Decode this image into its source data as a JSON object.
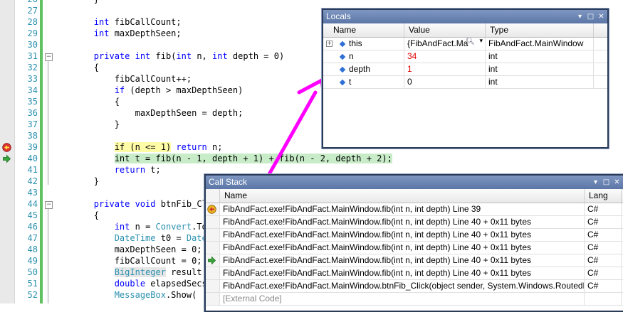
{
  "editor": {
    "lines": [
      {
        "n": "26",
        "segs": [
          {
            "t": "        }",
            "c": ""
          }
        ]
      },
      {
        "n": "27",
        "segs": [
          {
            "t": "",
            "c": ""
          }
        ]
      },
      {
        "n": "28",
        "segs": [
          {
            "t": "        ",
            "c": ""
          },
          {
            "t": "int",
            "c": "kw"
          },
          {
            "t": " fibCallCount;",
            "c": ""
          }
        ]
      },
      {
        "n": "29",
        "segs": [
          {
            "t": "        ",
            "c": ""
          },
          {
            "t": "int",
            "c": "kw"
          },
          {
            "t": " maxDepthSeen;",
            "c": ""
          }
        ]
      },
      {
        "n": "30",
        "segs": [
          {
            "t": "",
            "c": ""
          }
        ]
      },
      {
        "n": "31",
        "segs": [
          {
            "t": "        ",
            "c": ""
          },
          {
            "t": "private",
            "c": "kw"
          },
          {
            "t": " ",
            "c": ""
          },
          {
            "t": "int",
            "c": "kw"
          },
          {
            "t": " fib(",
            "c": ""
          },
          {
            "t": "int",
            "c": "kw"
          },
          {
            "t": " n, ",
            "c": ""
          },
          {
            "t": "int",
            "c": "kw"
          },
          {
            "t": " depth = 0)",
            "c": ""
          }
        ]
      },
      {
        "n": "32",
        "segs": [
          {
            "t": "        {",
            "c": ""
          }
        ]
      },
      {
        "n": "33",
        "segs": [
          {
            "t": "            fibCallCount++;",
            "c": ""
          }
        ]
      },
      {
        "n": "34",
        "segs": [
          {
            "t": "            ",
            "c": ""
          },
          {
            "t": "if",
            "c": "kw"
          },
          {
            "t": " (depth > maxDepthSeen)",
            "c": ""
          }
        ]
      },
      {
        "n": "35",
        "segs": [
          {
            "t": "            {",
            "c": ""
          }
        ]
      },
      {
        "n": "36",
        "segs": [
          {
            "t": "                maxDepthSeen = depth;",
            "c": ""
          }
        ]
      },
      {
        "n": "37",
        "segs": [
          {
            "t": "            }",
            "c": ""
          }
        ]
      },
      {
        "n": "38",
        "segs": [
          {
            "t": "",
            "c": ""
          }
        ]
      },
      {
        "n": "39",
        "segs": [
          {
            "t": "            ",
            "c": ""
          },
          {
            "t": "if (n <= 1)",
            "c": "hl-yellow"
          },
          {
            "t": " ",
            "c": ""
          },
          {
            "t": "return",
            "c": "kw"
          },
          {
            "t": " n;",
            "c": ""
          }
        ]
      },
      {
        "n": "40",
        "segs": [
          {
            "t": "            ",
            "c": ""
          },
          {
            "t": "int t = fib(n - 1, depth + 1) + fib(n - 2, depth + 2);",
            "c": "hl-green"
          }
        ]
      },
      {
        "n": "41",
        "segs": [
          {
            "t": "            ",
            "c": ""
          },
          {
            "t": "return",
            "c": "kw"
          },
          {
            "t": " t;",
            "c": ""
          }
        ]
      },
      {
        "n": "42",
        "segs": [
          {
            "t": "        }",
            "c": ""
          }
        ]
      },
      {
        "n": "43",
        "segs": [
          {
            "t": "",
            "c": ""
          }
        ]
      },
      {
        "n": "44",
        "segs": [
          {
            "t": "        ",
            "c": ""
          },
          {
            "t": "private",
            "c": "kw"
          },
          {
            "t": " ",
            "c": ""
          },
          {
            "t": "void",
            "c": "kw"
          },
          {
            "t": " btnFib_Cli",
            "c": ""
          }
        ]
      },
      {
        "n": "45",
        "segs": [
          {
            "t": "        {",
            "c": ""
          }
        ]
      },
      {
        "n": "46",
        "segs": [
          {
            "t": "            ",
            "c": ""
          },
          {
            "t": "int",
            "c": "kw"
          },
          {
            "t": " n = ",
            "c": ""
          },
          {
            "t": "Convert",
            "c": "ty"
          },
          {
            "t": ".To",
            "c": ""
          }
        ]
      },
      {
        "n": "47",
        "segs": [
          {
            "t": "            ",
            "c": ""
          },
          {
            "t": "DateTime",
            "c": "ty"
          },
          {
            "t": " t0 = ",
            "c": ""
          },
          {
            "t": "DateT",
            "c": "ty"
          }
        ]
      },
      {
        "n": "48",
        "segs": [
          {
            "t": "            maxDepthSeen = 0;",
            "c": ""
          }
        ]
      },
      {
        "n": "49",
        "segs": [
          {
            "t": "            fibCallCount = 0;",
            "c": ""
          }
        ]
      },
      {
        "n": "50",
        "segs": [
          {
            "t": "            ",
            "c": ""
          },
          {
            "t": "BigInteger",
            "c": "ty hl-gray"
          },
          {
            "t": " result",
            "c": ""
          }
        ]
      },
      {
        "n": "51",
        "segs": [
          {
            "t": "            ",
            "c": ""
          },
          {
            "t": "double",
            "c": "kw"
          },
          {
            "t": " elapsedSecs",
            "c": ""
          }
        ]
      },
      {
        "n": "52",
        "segs": [
          {
            "t": "            ",
            "c": ""
          },
          {
            "t": "MessageBox",
            "c": "ty"
          },
          {
            "t": ".Show(",
            "c": ""
          }
        ]
      }
    ]
  },
  "locals": {
    "title": "Locals",
    "columns": [
      "Name",
      "Value",
      "Type"
    ],
    "rows": [
      {
        "name": "this",
        "value": "{FibAndFact.Ma",
        "type": "FibAndFact.MainWindow",
        "expandable": true,
        "changed": false
      },
      {
        "name": "n",
        "value": "34",
        "type": "int",
        "expandable": false,
        "changed": true
      },
      {
        "name": "depth",
        "value": "1",
        "type": "int",
        "expandable": false,
        "changed": true
      },
      {
        "name": "t",
        "value": "0",
        "type": "int",
        "expandable": false,
        "changed": false
      }
    ]
  },
  "callstack": {
    "title": "Call Stack",
    "columns": [
      "Name",
      "Lang"
    ],
    "rows": [
      {
        "name": "FibAndFact.exe!FibAndFact.MainWindow.fib(int n, int depth) Line 39",
        "lang": "C#",
        "marker": "current",
        "external": false
      },
      {
        "name": "FibAndFact.exe!FibAndFact.MainWindow.fib(int n, int depth) Line 40 + 0x11 bytes",
        "lang": "C#",
        "marker": "",
        "external": false
      },
      {
        "name": "FibAndFact.exe!FibAndFact.MainWindow.fib(int n, int depth) Line 40 + 0x11 bytes",
        "lang": "C#",
        "marker": "",
        "external": false
      },
      {
        "name": "FibAndFact.exe!FibAndFact.MainWindow.fib(int n, int depth) Line 40 + 0x11 bytes",
        "lang": "C#",
        "marker": "",
        "external": false
      },
      {
        "name": "FibAndFact.exe!FibAndFact.MainWindow.fib(int n, int depth) Line 40 + 0x11 bytes",
        "lang": "C#",
        "marker": "caller",
        "external": false
      },
      {
        "name": "FibAndFact.exe!FibAndFact.MainWindow.fib(int n, int depth) Line 40 + 0x11 bytes",
        "lang": "C#",
        "marker": "",
        "external": false
      },
      {
        "name": "FibAndFact.exe!FibAndFact.MainWindow.btnFib_Click(object sender, System.Windows.RoutedEv",
        "lang": "C#",
        "marker": "",
        "external": false
      },
      {
        "name": "[External Code]",
        "lang": "",
        "marker": "",
        "external": true
      }
    ]
  },
  "window_buttons": {
    "dropdown": "▾",
    "maximize": "□",
    "close": "✕"
  },
  "colors": {
    "arrow": "#ff00ff",
    "title_bar": "#5b76a7",
    "changed_value": "#e00000"
  }
}
